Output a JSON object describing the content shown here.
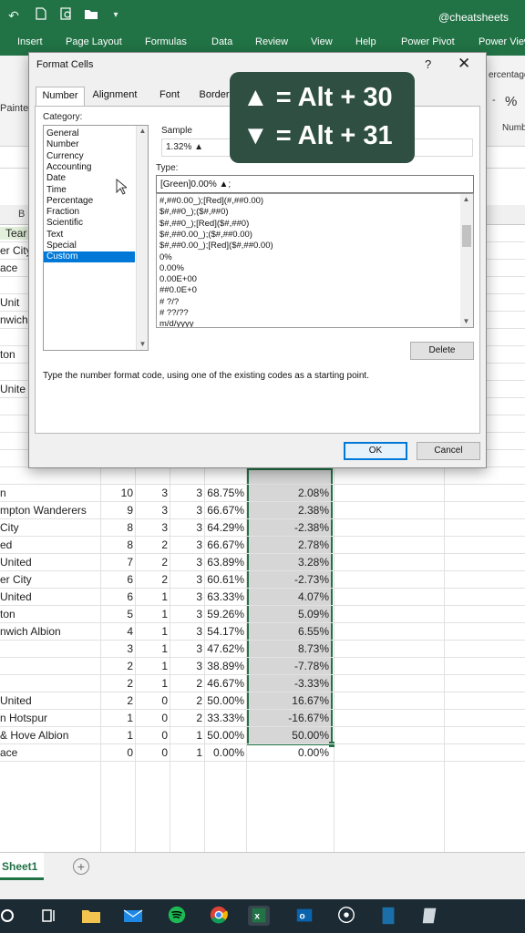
{
  "watermark": "@cheatsheets",
  "ribbon_tabs": [
    "Insert",
    "Page Layout",
    "Formulas",
    "Data",
    "Review",
    "View",
    "Help",
    "Power Pivot",
    "Power View"
  ],
  "ribbon": {
    "clipboard_painter": "Painte",
    "number_format_partial": "ercentage",
    "percent_symbol": "%",
    "number_group": "Numb",
    "minus": "-"
  },
  "columns": {
    "b": "B"
  },
  "sheet_rows": [
    {
      "team": "Tear",
      "w": "",
      "d": "",
      "l": "",
      "pct": "",
      "chg": ""
    },
    {
      "team": "er City",
      "w": "",
      "d": "",
      "l": "",
      "pct": "",
      "chg": ""
    },
    {
      "team": "ace",
      "w": "",
      "d": "",
      "l": "",
      "pct": "",
      "chg": ""
    },
    {
      "team": "",
      "w": "",
      "d": "",
      "l": "",
      "pct": "",
      "chg": ""
    },
    {
      "team": " Unit",
      "w": "",
      "d": "",
      "l": "",
      "pct": "",
      "chg": ""
    },
    {
      "team": "nwich",
      "w": "",
      "d": "",
      "l": "",
      "pct": "",
      "chg": ""
    },
    {
      "team": "",
      "w": "",
      "d": "",
      "l": "",
      "pct": "",
      "chg": ""
    },
    {
      "team": "ton",
      "w": "",
      "d": "",
      "l": "",
      "pct": "",
      "chg": ""
    },
    {
      "team": "",
      "w": "",
      "d": "",
      "l": "",
      "pct": "",
      "chg": ""
    },
    {
      "team": "Unite",
      "w": "",
      "d": "",
      "l": "",
      "pct": "",
      "chg": ""
    },
    {
      "team": "",
      "w": "",
      "d": "",
      "l": "",
      "pct": "",
      "chg": ""
    },
    {
      "team": "",
      "w": "",
      "d": "",
      "l": "",
      "pct": "",
      "chg": ""
    },
    {
      "team": "",
      "w": "",
      "d": "",
      "l": "",
      "pct": "",
      "chg": ""
    },
    {
      "team": "",
      "w": "",
      "d": "",
      "l": "",
      "pct": "",
      "chg": ""
    },
    {
      "team": "",
      "w": "",
      "d": "",
      "l": "",
      "pct": "",
      "chg": ""
    },
    {
      "team": "n",
      "w": "10",
      "d": "3",
      "l": "3",
      "pct": "68.75%",
      "chg": "2.08%"
    },
    {
      "team": "mpton Wanderers",
      "w": "9",
      "d": "3",
      "l": "3",
      "pct": "66.67%",
      "chg": "2.38%"
    },
    {
      "team": "City",
      "w": "8",
      "d": "3",
      "l": "3",
      "pct": "64.29%",
      "chg": "-2.38%"
    },
    {
      "team": "ed",
      "w": "8",
      "d": "2",
      "l": "3",
      "pct": "66.67%",
      "chg": "2.78%"
    },
    {
      "team": "United",
      "w": "7",
      "d": "2",
      "l": "3",
      "pct": "63.89%",
      "chg": "3.28%"
    },
    {
      "team": "er City",
      "w": "6",
      "d": "2",
      "l": "3",
      "pct": "60.61%",
      "chg": "-2.73%"
    },
    {
      "team": " United",
      "w": "6",
      "d": "1",
      "l": "3",
      "pct": "63.33%",
      "chg": "4.07%"
    },
    {
      "team": "ton",
      "w": "5",
      "d": "1",
      "l": "3",
      "pct": "59.26%",
      "chg": "5.09%"
    },
    {
      "team": "nwich Albion",
      "w": "4",
      "d": "1",
      "l": "3",
      "pct": "54.17%",
      "chg": "6.55%"
    },
    {
      "team": "",
      "w": "3",
      "d": "1",
      "l": "3",
      "pct": "47.62%",
      "chg": "8.73%"
    },
    {
      "team": "",
      "w": "2",
      "d": "1",
      "l": "3",
      "pct": "38.89%",
      "chg": "-7.78%"
    },
    {
      "team": "",
      "w": "2",
      "d": "1",
      "l": "2",
      "pct": "46.67%",
      "chg": "-3.33%"
    },
    {
      "team": " United",
      "w": "2",
      "d": "0",
      "l": "2",
      "pct": "50.00%",
      "chg": "16.67%"
    },
    {
      "team": "n Hotspur",
      "w": "1",
      "d": "0",
      "l": "2",
      "pct": "33.33%",
      "chg": "-16.67%"
    },
    {
      "team": "& Hove Albion",
      "w": "1",
      "d": "0",
      "l": "1",
      "pct": "50.00%",
      "chg": "50.00%"
    },
    {
      "team": "ace",
      "w": "0",
      "d": "0",
      "l": "1",
      "pct": "0.00%",
      "chg": "0.00%"
    }
  ],
  "sheet_tab": {
    "name": "Sheet1",
    "add": "+"
  },
  "dialog": {
    "title": "Format Cells",
    "help": "?",
    "close": "✕",
    "tabs": [
      "Number",
      "Alignment",
      "Font",
      "Border"
    ],
    "category_label": "Category:",
    "categories": [
      "General",
      "Number",
      "Currency",
      "Accounting",
      "Date",
      "Time",
      "Percentage",
      "Fraction",
      "Scientific",
      "Text",
      "Special",
      "Custom"
    ],
    "selected_category": "Custom",
    "sample_label": "Sample",
    "sample_value": "1.32% ▲",
    "type_label": "Type:",
    "type_value": "[Green]0.00% ▲;",
    "type_list": [
      "#,##0.00_);[Red](#,##0.00)",
      "$#,##0_);($#,##0)",
      "$#,##0_);[Red]($#,##0)",
      "$#,##0.00_);($#,##0.00)",
      "$#,##0.00_);[Red]($#,##0.00)",
      "0%",
      "0.00%",
      "0.00E+00",
      "##0.0E+0",
      "# ?/?",
      "# ??/??",
      "m/d/yyyy"
    ],
    "delete_label": "Delete",
    "hint": "Type the number format code, using one of the existing codes as a starting point.",
    "ok_label": "OK",
    "cancel_label": "Cancel"
  },
  "tip": {
    "line1": "▲ = Alt + 30",
    "line2": "▼ = Alt + 31"
  },
  "taskbar_icons": [
    "windows-icon",
    "task-view-icon",
    "file-explorer-icon",
    "mail-icon",
    "spotify-icon",
    "chrome-icon",
    "excel-icon",
    "outlook-icon",
    "obs-icon",
    "blue-app-icon",
    "notes-icon"
  ],
  "colors": {
    "excel_green": "#217346",
    "tip_bg": "#2e4f41",
    "selection_blue": "#0078d7"
  }
}
